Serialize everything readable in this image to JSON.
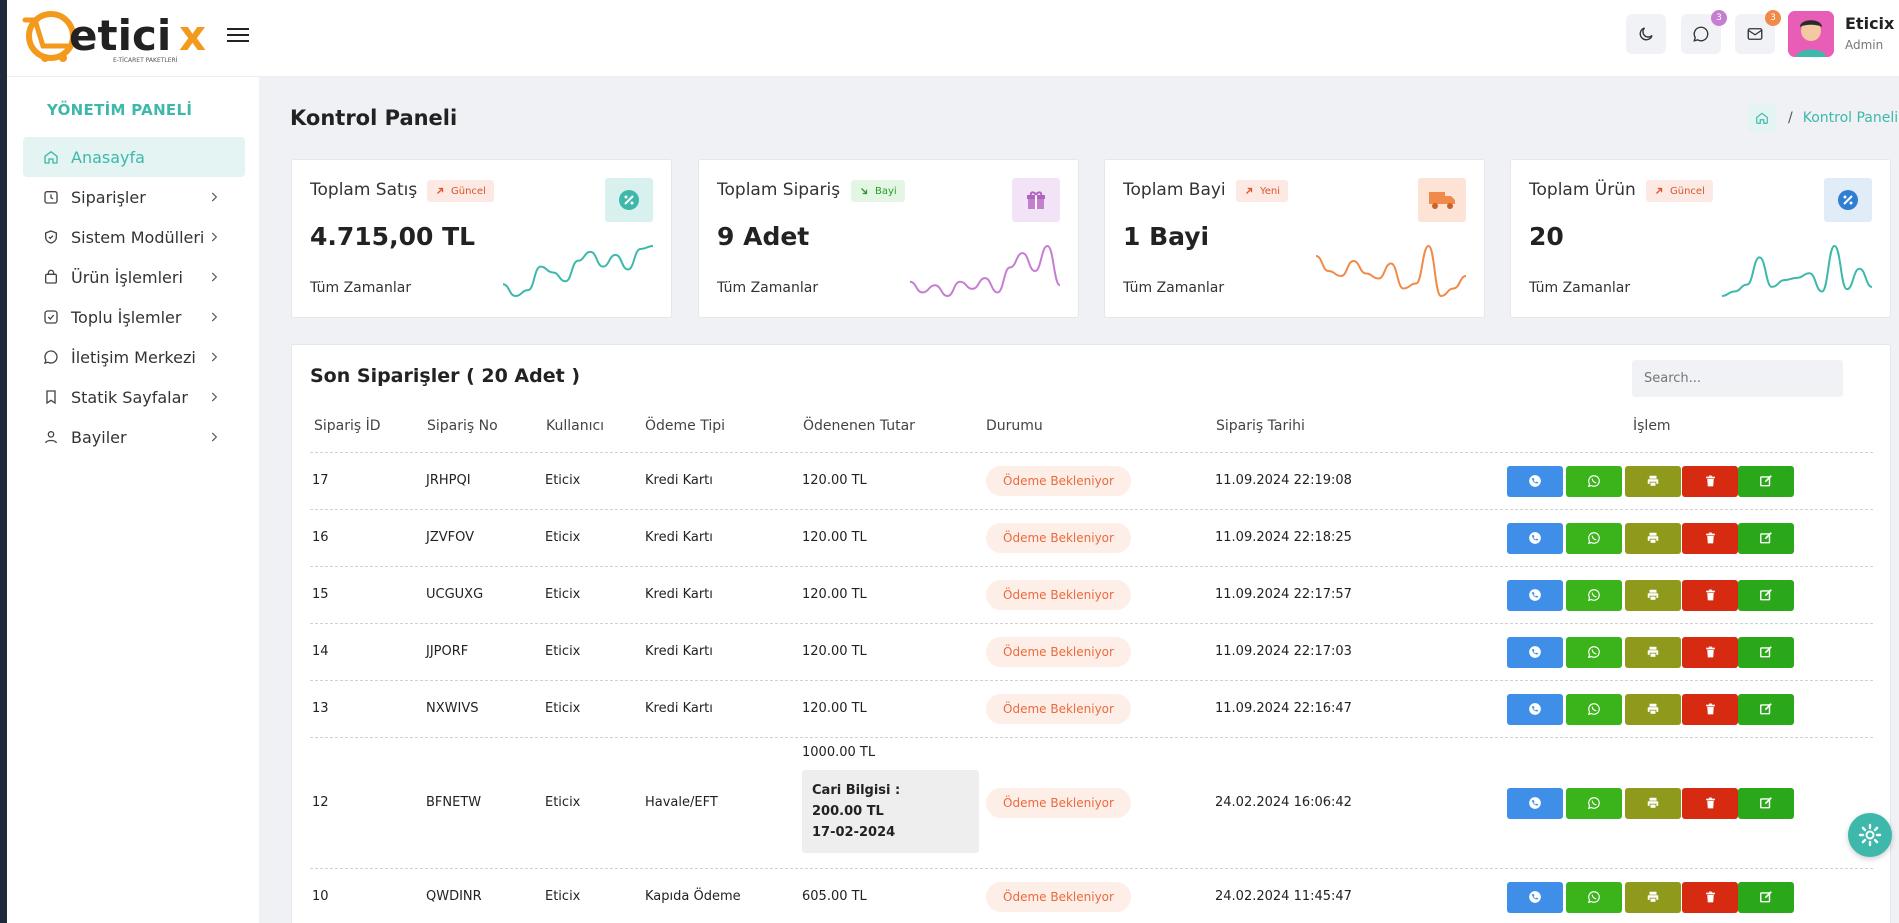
{
  "brand": {
    "name": "eticix",
    "tagline": "E-TİCARET PAKETLERİ"
  },
  "header": {
    "chat_badge": "3",
    "mail_badge": "3",
    "user": {
      "name": "Eticix",
      "role": "Admin"
    }
  },
  "sidebar": {
    "title": "YÖNETİM PANELİ",
    "items": [
      {
        "label": "Anasayfa",
        "icon": "home-icon",
        "active": true
      },
      {
        "label": "Siparişler",
        "icon": "clock-icon"
      },
      {
        "label": "Sistem Modülleri",
        "icon": "shield-icon"
      },
      {
        "label": "Ürün İşlemleri",
        "icon": "bag-icon"
      },
      {
        "label": "Toplu İşlemler",
        "icon": "check-square-icon"
      },
      {
        "label": "İletişim Merkezi",
        "icon": "chat-icon"
      },
      {
        "label": "Statik Sayfalar",
        "icon": "bookmark-icon"
      },
      {
        "label": "Bayiler",
        "icon": "user-icon"
      }
    ]
  },
  "page": {
    "title": "Kontrol Paneli",
    "breadcrumb": "Kontrol Paneli"
  },
  "cards": [
    {
      "title": "Toplam Satış",
      "tag": "Güncel",
      "value": "4.715,00 TL",
      "sub": "Tüm Zamanlar",
      "color": "#3eb8aa",
      "spark": [
        18,
        10,
        14,
        30,
        26,
        20,
        34,
        40,
        30,
        38,
        28,
        42,
        44
      ]
    },
    {
      "title": "Toplam Sipariş",
      "tag": "Bayi",
      "value": "9 Adet",
      "sub": "Tüm Zamanlar",
      "color": "#c57fd0",
      "spark": [
        14,
        8,
        12,
        6,
        14,
        10,
        16,
        8,
        22,
        30,
        20,
        34,
        12
      ]
    },
    {
      "title": "Toplam Bayi",
      "tag": "Yeni",
      "value": "1 Bayi",
      "sub": "Tüm Zamanlar",
      "color": "#ef8a4a",
      "spark": [
        40,
        28,
        24,
        36,
        26,
        22,
        34,
        14,
        18,
        48,
        8,
        14,
        24
      ]
    },
    {
      "title": "Toplam Ürün",
      "tag": "Güncel",
      "value": "20",
      "sub": "Tüm Zamanlar",
      "color": "#3eb8aa",
      "spark": [
        6,
        10,
        16,
        40,
        14,
        20,
        22,
        26,
        10,
        50,
        12,
        30,
        14
      ]
    }
  ],
  "orders": {
    "title": "Son Siparişler ( 20 Adet )",
    "search_placeholder": "Search...",
    "columns": [
      "Sipariş İD",
      "Sipariş No",
      "Kullanıcı",
      "Ödeme Tipi",
      "Ödenenen Tutar",
      "Durumu",
      "Sipariş Tarihi",
      "İşlem"
    ],
    "rows": [
      {
        "id": "17",
        "no": "JRHPQI",
        "user": "Eticix",
        "type": "Kredi Kartı",
        "amount": "120.00 TL",
        "status": "Ödeme Bekleniyor",
        "date": "11.09.2024 22:19:08"
      },
      {
        "id": "16",
        "no": "JZVFOV",
        "user": "Eticix",
        "type": "Kredi Kartı",
        "amount": "120.00 TL",
        "status": "Ödeme Bekleniyor",
        "date": "11.09.2024 22:18:25"
      },
      {
        "id": "15",
        "no": "UCGUXG",
        "user": "Eticix",
        "type": "Kredi Kartı",
        "amount": "120.00 TL",
        "status": "Ödeme Bekleniyor",
        "date": "11.09.2024 22:17:57"
      },
      {
        "id": "14",
        "no": "JJPORF",
        "user": "Eticix",
        "type": "Kredi Kartı",
        "amount": "120.00 TL",
        "status": "Ödeme Bekleniyor",
        "date": "11.09.2024 22:17:03"
      },
      {
        "id": "13",
        "no": "NXWIVS",
        "user": "Eticix",
        "type": "Kredi Kartı",
        "amount": "120.00 TL",
        "status": "Ödeme Bekleniyor",
        "date": "11.09.2024 22:16:47"
      },
      {
        "id": "12",
        "no": "BFNETW",
        "user": "Eticix",
        "type": "Havale/EFT",
        "amount": "1000.00 TL",
        "status": "Ödeme Bekleniyor",
        "date": "24.02.2024 16:06:42",
        "cari": {
          "label": "Cari Bilgisi :",
          "amount": "200.00 TL",
          "date": "17-02-2024"
        }
      },
      {
        "id": "10",
        "no": "QWDINR",
        "user": "Eticix",
        "type": "Kapıda Ödeme",
        "amount": "605.00 TL",
        "status": "Ödeme Bekleniyor",
        "date": "24.02.2024 11:45:47"
      }
    ]
  }
}
